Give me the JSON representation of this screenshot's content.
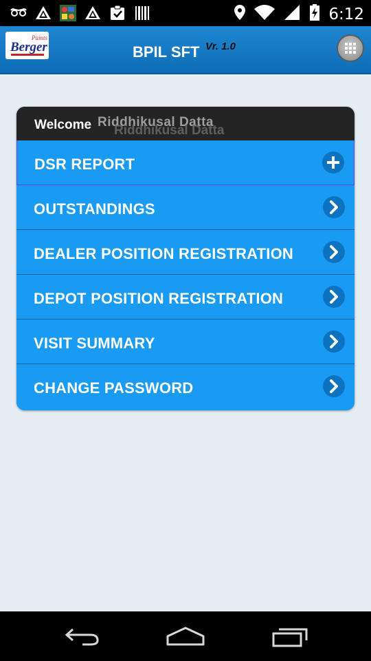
{
  "status_bar": {
    "time": "6:12",
    "icons": [
      "glasses-icon",
      "warning-icon",
      "app-thumbnail-icon",
      "warning-icon",
      "clipboard-check-icon",
      "barcode-icon",
      "location-icon",
      "wifi-icon",
      "signal-icon",
      "battery-icon"
    ]
  },
  "app_bar": {
    "logo_text": "Berger",
    "logo_sub": "Paints",
    "title": "BPIL SFT",
    "version": "Vr. 1.0",
    "menu_icon": "grid-icon"
  },
  "menu_card": {
    "welcome_label": "Welcome",
    "user_name": "Riddhikusal Datta",
    "items": [
      {
        "label": "DSR REPORT",
        "icon": "plus-icon"
      },
      {
        "label": "OUTSTANDINGS",
        "icon": "chevron-right-icon"
      },
      {
        "label": "DEALER POSITION REGISTRATION",
        "icon": "chevron-right-icon"
      },
      {
        "label": "DEPOT POSITION REGISTRATION",
        "icon": "chevron-right-icon"
      },
      {
        "label": "VISIT SUMMARY",
        "icon": "chevron-right-icon"
      },
      {
        "label": "CHANGE PASSWORD",
        "icon": "chevron-right-icon"
      }
    ]
  },
  "nav_bar": {
    "icons": [
      "back-icon",
      "home-icon",
      "recent-apps-icon"
    ]
  },
  "colors": {
    "app_bar": "#0e6db6",
    "menu_item": "#1a9bf3",
    "welcome_bar": "#242424",
    "background": "#e6edf3"
  }
}
